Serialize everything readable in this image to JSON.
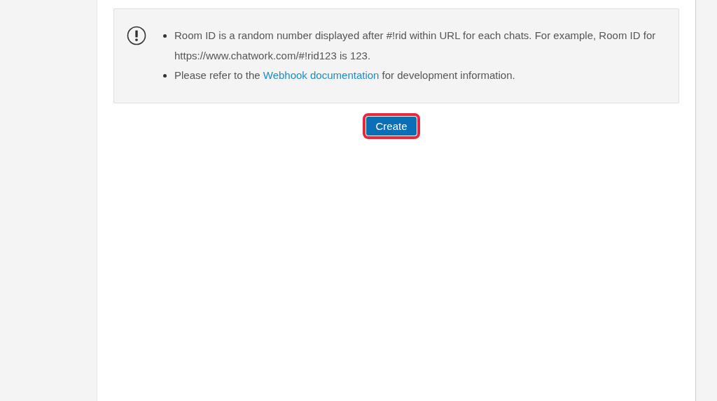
{
  "notice": {
    "items": [
      {
        "parts": [
          {
            "kind": "text",
            "text": "Room ID is a random number displayed after #!rid within URL for each chats. For example, Room ID for https://www.chatwork.com/#!rid123 is 123."
          }
        ]
      },
      {
        "parts": [
          {
            "kind": "text",
            "text": "Please refer to the "
          },
          {
            "kind": "link",
            "text": "Webhook documentation"
          },
          {
            "kind": "text",
            "text": " for development information."
          }
        ]
      }
    ]
  },
  "create_button": {
    "label": "Create",
    "highlighted": true
  }
}
